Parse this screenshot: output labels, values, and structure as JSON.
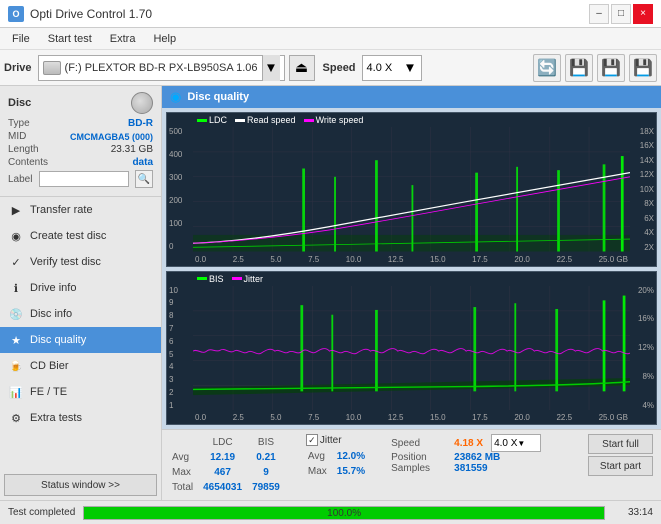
{
  "titlebar": {
    "title": "Opti Drive Control 1.70",
    "minimize": "–",
    "maximize": "□",
    "close": "×"
  },
  "menu": {
    "items": [
      "File",
      "Start test",
      "Extra",
      "Help"
    ]
  },
  "toolbar": {
    "drive_label": "Drive",
    "drive_value": "(F:)  PLEXTOR BD-R  PX-LB950SA 1.06",
    "speed_label": "Speed",
    "speed_value": "4.0 X"
  },
  "disc": {
    "label": "Disc",
    "type_label": "Type",
    "type_value": "BD-R",
    "mid_label": "MID",
    "mid_value": "CMCMAGBA5 (000)",
    "length_label": "Length",
    "length_value": "23.31 GB",
    "contents_label": "Contents",
    "contents_value": "data",
    "label_label": "Label",
    "label_value": ""
  },
  "nav": {
    "items": [
      {
        "id": "transfer-rate",
        "label": "Transfer rate",
        "icon": "▶"
      },
      {
        "id": "create-test-disc",
        "label": "Create test disc",
        "icon": "◉"
      },
      {
        "id": "verify-test-disc",
        "label": "Verify test disc",
        "icon": "✓"
      },
      {
        "id": "drive-info",
        "label": "Drive info",
        "icon": "ℹ"
      },
      {
        "id": "disc-info",
        "label": "Disc info",
        "icon": "💿"
      },
      {
        "id": "disc-quality",
        "label": "Disc quality",
        "icon": "★",
        "active": true
      },
      {
        "id": "cd-bier",
        "label": "CD Bier",
        "icon": "🍺"
      },
      {
        "id": "fe-te",
        "label": "FE / TE",
        "icon": "📊"
      },
      {
        "id": "extra-tests",
        "label": "Extra tests",
        "icon": "⚙"
      }
    ],
    "status_btn": "Status window >>"
  },
  "content": {
    "title": "Disc quality",
    "chart1": {
      "legend": [
        {
          "label": "LDC",
          "color": "#00ff00"
        },
        {
          "label": "Read speed",
          "color": "#ffffff"
        },
        {
          "label": "Write speed",
          "color": "#ff00ff"
        }
      ],
      "y_left": [
        "500",
        "400",
        "300",
        "200",
        "100",
        "0"
      ],
      "y_right": [
        "18X",
        "16X",
        "14X",
        "12X",
        "10X",
        "8X",
        "6X",
        "4X",
        "2X"
      ],
      "x": [
        "0.0",
        "2.5",
        "5.0",
        "7.5",
        "10.0",
        "12.5",
        "15.0",
        "17.5",
        "20.0",
        "22.5",
        "25.0 GB"
      ]
    },
    "chart2": {
      "legend": [
        {
          "label": "BIS",
          "color": "#00ff00"
        },
        {
          "label": "Jitter",
          "color": "#ff00ff"
        }
      ],
      "y_left": [
        "10",
        "9",
        "8",
        "7",
        "6",
        "5",
        "4",
        "3",
        "2",
        "1"
      ],
      "y_right": [
        "20%",
        "16%",
        "12%",
        "8%",
        "4%"
      ],
      "x": [
        "0.0",
        "2.5",
        "5.0",
        "7.5",
        "10.0",
        "12.5",
        "15.0",
        "17.5",
        "20.0",
        "22.5",
        "25.0 GB"
      ]
    }
  },
  "stats": {
    "columns": [
      "LDC",
      "BIS",
      "",
      "Jitter",
      "Speed",
      ""
    ],
    "avg_label": "Avg",
    "avg_ldc": "12.19",
    "avg_bis": "0.21",
    "avg_jitter": "12.0%",
    "max_label": "Max",
    "max_ldc": "467",
    "max_bis": "9",
    "max_jitter": "15.7%",
    "total_label": "Total",
    "total_ldc": "4654031",
    "total_bis": "79859",
    "jitter_checked": true,
    "speed_label": "Speed",
    "speed_value": "4.18 X",
    "speed_select": "4.0 X",
    "position_label": "Position",
    "position_value": "23862 MB",
    "samples_label": "Samples",
    "samples_value": "381559",
    "start_full": "Start full",
    "start_part": "Start part"
  },
  "statusbar": {
    "status_text": "Test completed",
    "progress_pct": "100.0%",
    "time": "33:14",
    "progress_value": 100
  }
}
